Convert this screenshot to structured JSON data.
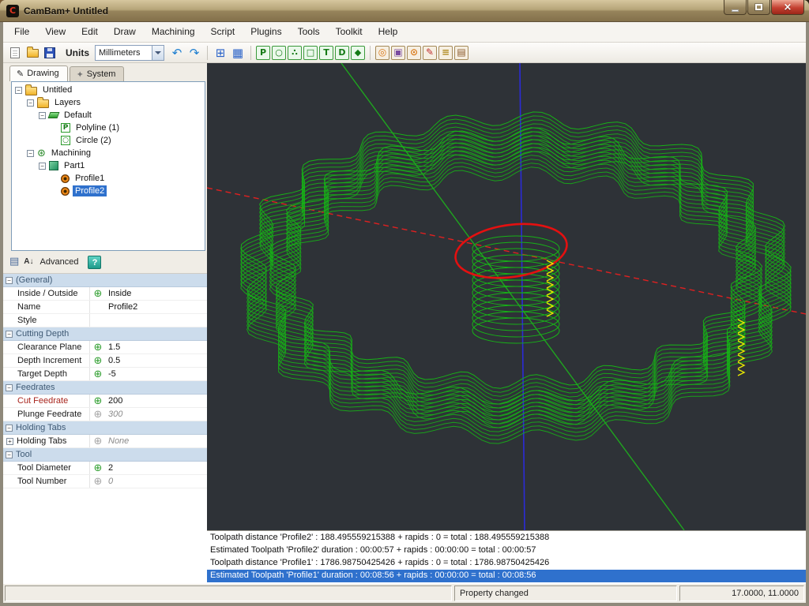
{
  "window": {
    "title": "CamBam+  Untitled"
  },
  "menu": {
    "items": [
      "File",
      "View",
      "Edit",
      "Draw",
      "Machining",
      "Script",
      "Plugins",
      "Tools",
      "Toolkit",
      "Help"
    ]
  },
  "toolbar": {
    "units_label": "Units",
    "units_value": "Millimeters",
    "items_left": [
      {
        "kind": "page",
        "name": "new-file-button"
      },
      {
        "kind": "folder",
        "name": "open-file-button"
      },
      {
        "kind": "floppy",
        "name": "save-file-button"
      }
    ],
    "items_right": [
      {
        "kind": "glyph",
        "name": "undo-button",
        "glyph": "↶",
        "color": "#1f7fd0"
      },
      {
        "kind": "glyph",
        "name": "redo-button",
        "glyph": "↷",
        "color": "#1f7fd0"
      },
      {
        "kind": "sep"
      },
      {
        "kind": "glyph",
        "name": "snap-grid-button",
        "glyph": "⊞",
        "color": "#2b63c9"
      },
      {
        "kind": "glyph",
        "name": "grid-button",
        "glyph": "▦",
        "color": "#2b63c9"
      },
      {
        "kind": "sep"
      },
      {
        "kind": "green",
        "name": "draw-polyline-button",
        "glyph": "P"
      },
      {
        "kind": "green",
        "name": "draw-circle-button",
        "glyph": "○"
      },
      {
        "kind": "green",
        "name": "draw-point-button",
        "glyph": "∴"
      },
      {
        "kind": "green",
        "name": "draw-rect-button",
        "glyph": "□"
      },
      {
        "kind": "green",
        "name": "draw-text-button",
        "glyph": "T"
      },
      {
        "kind": "green",
        "name": "draw-arc-button",
        "glyph": "D"
      },
      {
        "kind": "green",
        "name": "draw-surface-button",
        "glyph": "◆"
      },
      {
        "kind": "sep"
      },
      {
        "kind": "mach",
        "name": "profile-mop-button",
        "glyph": "◎",
        "color": "#d97817"
      },
      {
        "kind": "mach",
        "name": "pocket-mop-button",
        "glyph": "▣",
        "color": "#7a4ba0"
      },
      {
        "kind": "mach",
        "name": "drill-mop-button",
        "glyph": "⊙",
        "color": "#d97817"
      },
      {
        "kind": "mach",
        "name": "engrave-mop-button",
        "glyph": "✎",
        "color": "#c03030"
      },
      {
        "kind": "mach",
        "name": "lathe-mop-button",
        "glyph": "≡",
        "color": "#b08a20"
      },
      {
        "kind": "mach",
        "name": "gcode-button",
        "glyph": "▤",
        "color": "#8a5a2a"
      }
    ]
  },
  "tabs": {
    "drawing": "Drawing",
    "system": "System"
  },
  "tree": {
    "items": [
      {
        "label": "Untitled",
        "level": 0,
        "icon": "folder",
        "expander": "-"
      },
      {
        "label": "Layers",
        "level": 1,
        "icon": "folder",
        "expander": "-"
      },
      {
        "label": "Default",
        "level": 2,
        "icon": "layer",
        "expander": "-"
      },
      {
        "label": "Polyline (1)",
        "level": 3,
        "icon": "polyline"
      },
      {
        "label": "Circle (2)",
        "level": 3,
        "icon": "circle"
      },
      {
        "label": "Machining",
        "level": 1,
        "icon": "machining",
        "expander": "-"
      },
      {
        "label": "Part1",
        "level": 2,
        "icon": "part",
        "expander": "-"
      },
      {
        "label": "Profile1",
        "level": 3,
        "icon": "profile"
      },
      {
        "label": "Profile2",
        "level": 3,
        "icon": "profile",
        "selected": true
      }
    ]
  },
  "properties": {
    "advanced_label": "Advanced",
    "help_label": "?",
    "rows": [
      {
        "type": "category",
        "label": "(General)"
      },
      {
        "type": "prop",
        "label": "Inside / Outside",
        "icon": "green",
        "value": "Inside"
      },
      {
        "type": "prop",
        "label": "Name",
        "icon": "none",
        "value": "Profile2"
      },
      {
        "type": "prop",
        "label": "Style",
        "icon": "none",
        "value": ""
      },
      {
        "type": "category",
        "label": "Cutting Depth"
      },
      {
        "type": "prop",
        "label": "Clearance Plane",
        "icon": "green",
        "value": "1.5"
      },
      {
        "type": "prop",
        "label": "Depth Increment",
        "icon": "green",
        "value": "0.5"
      },
      {
        "type": "prop",
        "label": "Target Depth",
        "icon": "green",
        "value": "-5"
      },
      {
        "type": "category",
        "label": "Feedrates"
      },
      {
        "type": "prop",
        "label": "Cut Feedrate",
        "icon": "green",
        "value": "200",
        "emphasis": true
      },
      {
        "type": "prop",
        "label": "Plunge Feedrate",
        "icon": "grey",
        "value": "300",
        "inherited": true
      },
      {
        "type": "category",
        "label": "Holding Tabs"
      },
      {
        "type": "prop",
        "label": "Holding Tabs",
        "icon": "grey",
        "value": "None",
        "inherited": true,
        "expandable": true
      },
      {
        "type": "category",
        "label": "Tool"
      },
      {
        "type": "prop",
        "label": "Tool Diameter",
        "icon": "green",
        "value": "2"
      },
      {
        "type": "prop",
        "label": "Tool Number",
        "icon": "grey",
        "value": "0",
        "inherited": true
      }
    ]
  },
  "viewport": {
    "colors": {
      "background": "#2e3237",
      "toolpath": "#17b217",
      "axis_x": "#e02020",
      "axis_y": "#1fa51f",
      "axis_z": "#2b2bd8",
      "highlight": "#e41010",
      "holding_tabs": "#e8e800"
    }
  },
  "log": {
    "lines": [
      "Toolpath distance 'Profile2' : 188.495559215388 + rapids : 0 = total : 188.495559215388",
      "Estimated Toolpath 'Profile2' duration : 00:00:57 + rapids : 00:00:00 = total : 00:00:57",
      "Toolpath distance 'Profile1' : 1786.98750425426 + rapids : 0 = total : 1786.98750425426",
      "Estimated Toolpath 'Profile1' duration : 00:08:56 + rapids : 00:00:00 = total : 00:08:56"
    ],
    "selected_index": 3
  },
  "status": {
    "message": "Property changed",
    "coords": "17.0000, 11.0000"
  }
}
